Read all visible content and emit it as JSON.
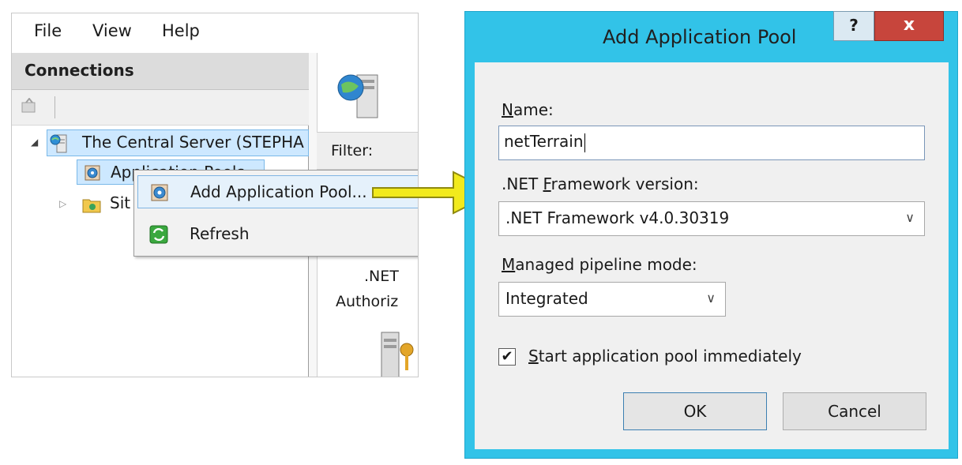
{
  "iis": {
    "menu": [
      "File",
      "View",
      "Help"
    ],
    "connections_title": "Connections",
    "tree": {
      "server_label": "The Central Server (STEPHA",
      "app_pools_label": "Application Pools",
      "sites_label": "Sit"
    },
    "filter_label": "Filter:",
    "feature_labels": [
      ".NET",
      "Authoriz"
    ],
    "context_menu": [
      {
        "label": "Add Application Pool...",
        "icon": "app-pool-icon"
      },
      {
        "label": "Refresh",
        "icon": "refresh-icon"
      }
    ]
  },
  "dialog": {
    "title": "Add Application Pool",
    "help_label": "?",
    "close_label": "x",
    "name_label_u": "N",
    "name_label_rest": "ame:",
    "name_value": "netTerrain",
    "framework_label_pre": ".NET ",
    "framework_label_u": "F",
    "framework_label_rest": "ramework version:",
    "framework_value": ".NET Framework v4.0.30319",
    "pipeline_label_u": "M",
    "pipeline_label_rest": "anaged pipeline mode:",
    "pipeline_value": "Integrated",
    "checkbox_checked": true,
    "checkbox_mark": "✔",
    "checkbox_label_u": "S",
    "checkbox_label_rest": "tart application pool immediately",
    "ok_label": "OK",
    "cancel_label": "Cancel"
  },
  "colors": {
    "dialog_frame": "#32c3e8",
    "close_button": "#c7453c",
    "arrow_fill": "#f2ea1c",
    "selection": "#cde8ff"
  }
}
